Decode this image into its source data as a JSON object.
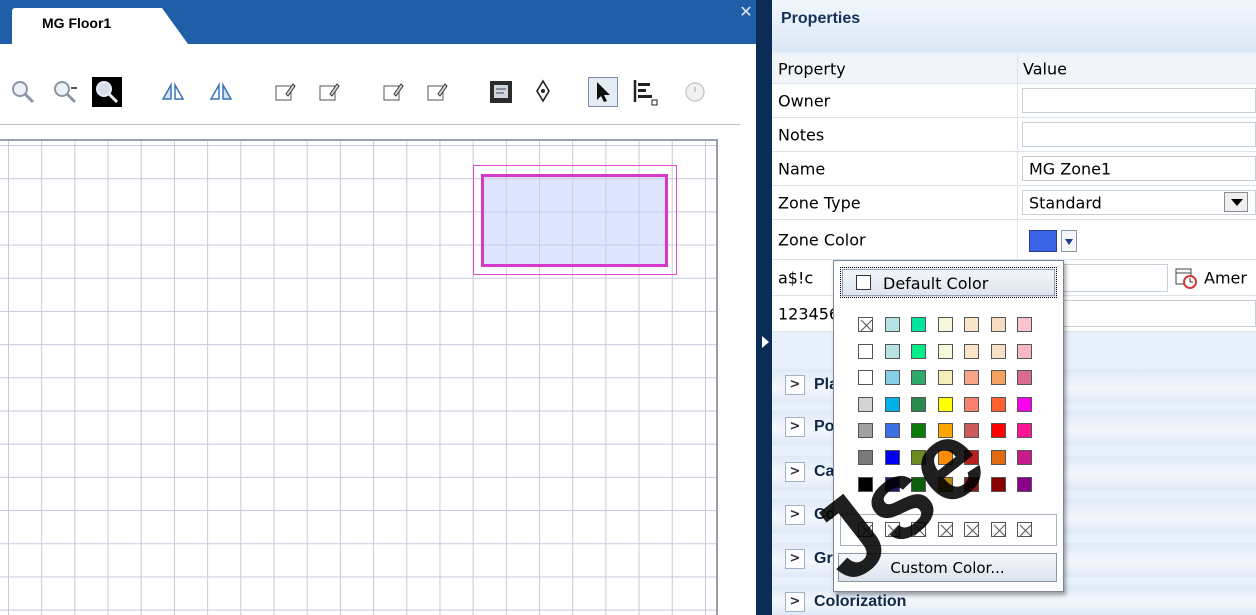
{
  "window": {
    "tab_title": "MG Floor1",
    "close_glyph": "✕"
  },
  "toolbar": {
    "icons": [
      "zoom-out-icon",
      "zoom-out-dropdown-icon",
      "zoom-actual-icon",
      "flip-horizontal-icon",
      "flip-vertical-icon",
      "edit-note-icon",
      "edit-note-2-icon",
      "edit-note-3-icon",
      "edit-note-4-icon",
      "text-frame-icon",
      "pen-icon",
      "select-arrow-icon",
      "align-icon",
      "clock-icon"
    ]
  },
  "properties": {
    "title": "Properties",
    "header": {
      "property": "Property",
      "value": "Value"
    },
    "rows": [
      {
        "label": "Owner",
        "value": ""
      },
      {
        "label": "Notes",
        "value": ""
      },
      {
        "label": "Name",
        "value": "MG Zone1"
      },
      {
        "label": "Zone Type",
        "value": "Standard"
      },
      {
        "label": "Zone Color",
        "value": ""
      },
      {
        "label": "a$!c",
        "value": "Amer"
      },
      {
        "label": "123456",
        "value": ""
      }
    ],
    "zone_color": "#3a63e6",
    "sections": [
      "Pla",
      "Po",
      "Ca",
      "Co",
      "Gr",
      "Colorization"
    ]
  },
  "color_popup": {
    "default_label": "Default Color",
    "custom_label": "Custom Color...",
    "swatches": [
      [
        "none",
        "#b6e3e3",
        "#00e6a0",
        "#f7f7dc",
        "#fbe5c8",
        "#f6dcc3",
        "#f9c4cc"
      ],
      [
        "#ffffff",
        "#b6e3e3",
        "#00ee88",
        "#f8f8dd",
        "#fbe5c8",
        "#f7e0c4",
        "#f6b8c3"
      ],
      [
        "#ffffff",
        "#87cfe4",
        "#2ea86b",
        "#f4efb8",
        "#f6a586",
        "#f4a15f",
        "#d96c8c"
      ],
      [
        "#d4d4d4",
        "#00b0e8",
        "#2a8a4c",
        "#ffff00",
        "#f9806e",
        "#ff6230",
        "#ff00ee"
      ],
      [
        "#a0a0a0",
        "#3e6fe6",
        "#0b7b0b",
        "#ffa500",
        "#cc5b5b",
        "#ff0000",
        "#ff1493"
      ],
      [
        "#7a7a7a",
        "#0000f0",
        "#6b8a22",
        "#ff8c00",
        "#b82020",
        "#e06a10",
        "#c81c8c"
      ],
      [
        "#000000",
        "#1a1a6e",
        "#0b5e0b",
        "#b8860b",
        "#8b1a1a",
        "#8b0000",
        "#8b008b"
      ]
    ],
    "recent_count": 7
  },
  "accent_colors": {
    "topbar": "#1e5fa8",
    "splitter": "#0b2c57",
    "zone_border": "#d639c9"
  }
}
